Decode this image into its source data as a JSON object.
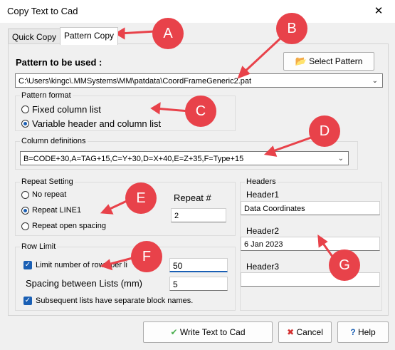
{
  "window": {
    "title": "Copy Text to Cad",
    "close_glyph": "✕"
  },
  "tabs": [
    {
      "label": "Quick Copy"
    },
    {
      "label": "Pattern Copy"
    }
  ],
  "pattern": {
    "label": "Pattern to be used :",
    "select_button": "Select Pattern",
    "path": "C:\\Users\\kingc\\.MMSystems\\MM\\patdata\\CoordFrameGeneric2.pat"
  },
  "pattern_format": {
    "title": "Pattern format",
    "options": [
      "Fixed column list",
      "Variable header and column list"
    ],
    "selected": 1
  },
  "column_defs": {
    "title": "Column definitions",
    "value": "B=CODE+30,A=TAG+15,C=Y+30,D=X+40,E=Z+35,F=Type+15"
  },
  "repeat": {
    "title": "Repeat Setting",
    "options": [
      "No repeat",
      "Repeat LINE1",
      "Repeat open spacing"
    ],
    "selected": 1,
    "repeat_label": "Repeat #",
    "repeat_value": "2"
  },
  "row_limit": {
    "title": "Row Limit",
    "limit_label": "Limit number of rows per li",
    "limit_value": "50",
    "spacing_label": "Spacing between Lists (mm)",
    "spacing_value": "5",
    "separate_label": "Subsequent lists have separate block names."
  },
  "headers": {
    "title": "Headers",
    "items": [
      {
        "label": "Header1",
        "value": "Data Coordinates"
      },
      {
        "label": "Header2",
        "value": "6 Jan 2023"
      },
      {
        "label": "Header3",
        "value": ""
      }
    ]
  },
  "buttons": {
    "write": "Write Text to Cad",
    "cancel": "Cancel",
    "help": "Help"
  },
  "callouts": [
    "A",
    "B",
    "C",
    "D",
    "E",
    "F",
    "G"
  ],
  "colors": {
    "callout": "#e8424a",
    "accent": "#1a5fb4",
    "ok_green": "#4caf50",
    "cancel_red": "#d32f2f"
  }
}
